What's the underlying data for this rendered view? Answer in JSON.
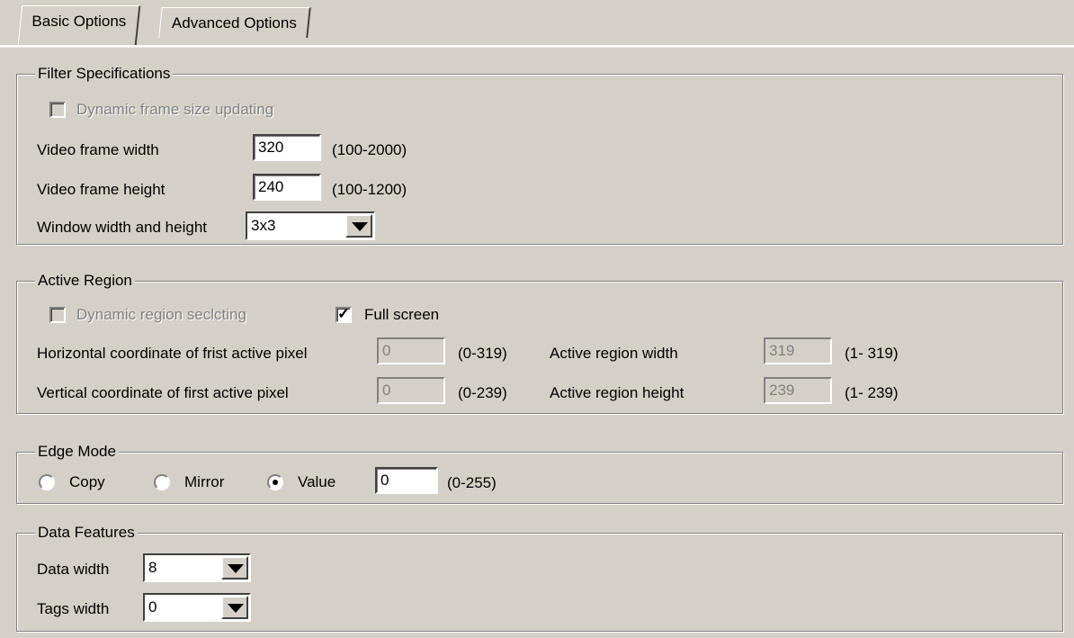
{
  "tabs": [
    {
      "label": "Basic Options",
      "active": true
    },
    {
      "label": "Advanced Options",
      "active": false
    }
  ],
  "filter_specifications": {
    "title": "Filter Specifications",
    "dynamic_frame_label": "Dynamic frame size updating",
    "width_label": "Video frame width",
    "width_value": "320",
    "width_range": "(100-2000)",
    "height_label": "Video frame height",
    "height_value": "240",
    "height_range": "(100-1200)",
    "window_label": "Window width and height",
    "window_value": "3x3"
  },
  "active_region": {
    "title": "Active Region",
    "dynamic_region_label": "Dynamic region seclcting",
    "full_screen_label": "Full screen",
    "full_screen_checked": true,
    "hcoord_label": "Horizontal coordinate of frist active pixel",
    "hcoord_value": "0",
    "hcoord_range": "(0-319)",
    "vcoord_label": "Vertical coordinate of first active pixel",
    "vcoord_value": "0",
    "vcoord_range": "(0-239)",
    "region_width_label": "Active region width",
    "region_width_value": "319",
    "region_width_range": "(1- 319)",
    "region_height_label": "Active region height",
    "region_height_value": "239",
    "region_height_range": "(1- 239)"
  },
  "edge_mode": {
    "title": "Edge Mode",
    "copy_label": "Copy",
    "mirror_label": "Mirror",
    "value_label": "Value",
    "selected": "Value",
    "value": "0",
    "range": "(0-255)"
  },
  "data_features": {
    "title": "Data Features",
    "data_width_label": "Data width",
    "data_width_value": "8",
    "tags_width_label": "Tags width",
    "tags_width_value": "0"
  },
  "icons": {
    "combo_arrow": "triangle-down-icon",
    "check": "check-icon",
    "radio": "radio-dot-icon"
  }
}
